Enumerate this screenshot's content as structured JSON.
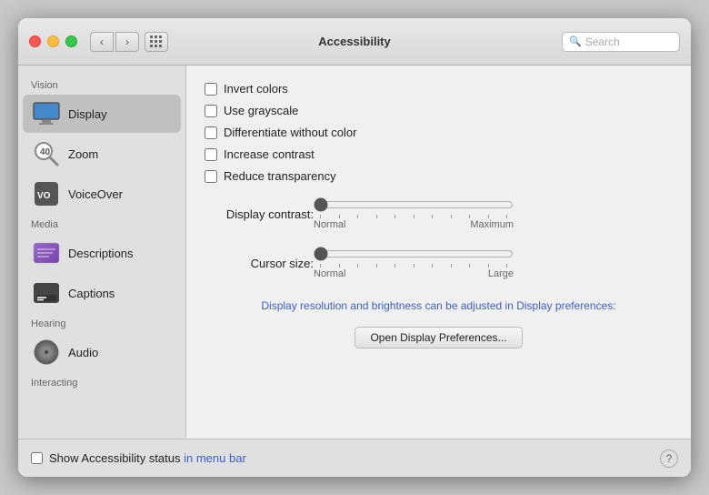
{
  "titlebar": {
    "title": "Accessibility",
    "search_placeholder": "Search",
    "back_label": "‹",
    "forward_label": "›"
  },
  "sidebar": {
    "sections": [
      {
        "label": "Vision",
        "items": [
          {
            "id": "display",
            "label": "Display",
            "icon": "display-icon",
            "active": true
          },
          {
            "id": "zoom",
            "label": "Zoom",
            "icon": "zoom-icon",
            "active": false
          },
          {
            "id": "voiceover",
            "label": "VoiceOver",
            "icon": "voiceover-icon",
            "active": false
          }
        ]
      },
      {
        "label": "Media",
        "items": [
          {
            "id": "descriptions",
            "label": "Descriptions",
            "icon": "descriptions-icon",
            "active": false
          },
          {
            "id": "captions",
            "label": "Captions",
            "icon": "captions-icon",
            "active": false
          }
        ]
      },
      {
        "label": "Hearing",
        "items": [
          {
            "id": "audio",
            "label": "Audio",
            "icon": "audio-icon",
            "active": false
          }
        ]
      },
      {
        "label": "Interacting",
        "items": []
      }
    ]
  },
  "content": {
    "checkboxes": [
      {
        "id": "invert",
        "label": "Invert colors",
        "checked": false
      },
      {
        "id": "grayscale",
        "label": "Use grayscale",
        "checked": false
      },
      {
        "id": "differentiate",
        "label": "Differentiate without color",
        "checked": false
      },
      {
        "id": "contrast",
        "label": "Increase contrast",
        "checked": false
      },
      {
        "id": "transparency",
        "label": "Reduce transparency",
        "checked": false
      }
    ],
    "sliders": [
      {
        "id": "display_contrast",
        "label": "Display contrast:",
        "min_label": "Normal",
        "max_label": "Maximum",
        "value": 0
      },
      {
        "id": "cursor_size",
        "label": "Cursor size:",
        "min_label": "Normal",
        "max_label": "Large",
        "value": 0
      }
    ],
    "note": "Display resolution and brightness can be adjusted in Display preferences:",
    "open_prefs_button": "Open Display Preferences..."
  },
  "bottom": {
    "status_label_pre": "Show Accessibility status ",
    "status_label_link": "in menu bar",
    "help_label": "?"
  }
}
